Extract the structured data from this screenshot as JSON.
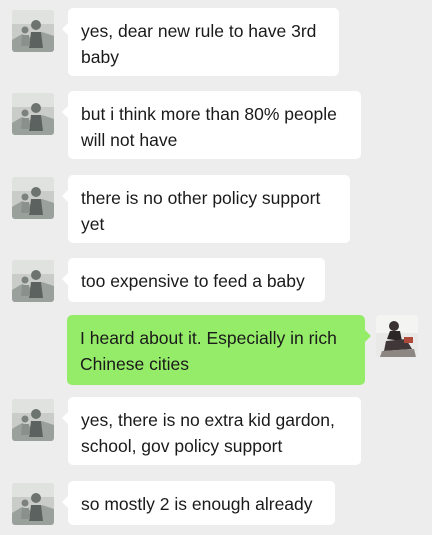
{
  "colors": {
    "background": "#ededed",
    "incoming_bubble": "#ffffff",
    "outgoing_bubble": "#95ec69",
    "text": "#1a1a1a"
  },
  "messages": [
    {
      "sender": "contact",
      "text": "yes, dear new rule to have 3rd baby"
    },
    {
      "sender": "contact",
      "text": "but i think more than 80% people will not have"
    },
    {
      "sender": "contact",
      "text": "there is no other policy support yet"
    },
    {
      "sender": "contact",
      "text": "too expensive to feed a baby"
    },
    {
      "sender": "me",
      "text": "I heard about it. Especially in rich Chinese cities"
    },
    {
      "sender": "contact",
      "text": "yes, there is no extra kid gardon, school, gov policy support"
    },
    {
      "sender": "contact",
      "text": "so mostly 2 is enough already"
    }
  ]
}
